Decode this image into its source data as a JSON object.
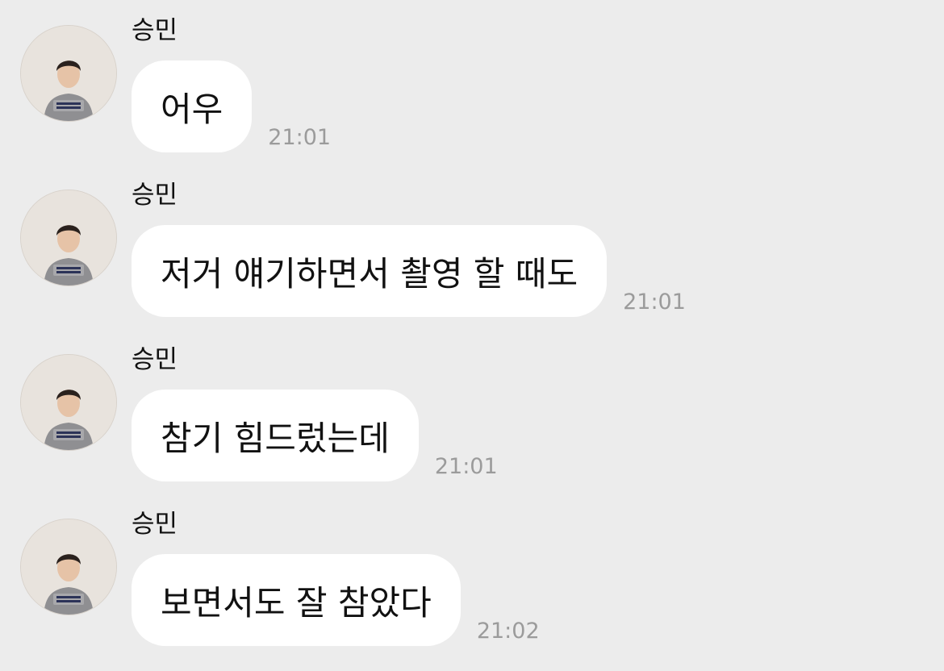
{
  "messages": [
    {
      "sender": "승민",
      "text": "어우",
      "time": "21:01"
    },
    {
      "sender": "승민",
      "text": "저거 얘기하면서 촬영 할 때도",
      "time": "21:01"
    },
    {
      "sender": "승민",
      "text": "참기 힘드렀는데",
      "time": "21:01"
    },
    {
      "sender": "승민",
      "text": "보면서도 잘 참았다",
      "time": "21:02"
    }
  ],
  "colors": {
    "background": "#ececec",
    "bubble": "#ffffff",
    "timestamp": "#9b9b9b"
  },
  "icons": {
    "avatar": "profile-photo-icon"
  }
}
